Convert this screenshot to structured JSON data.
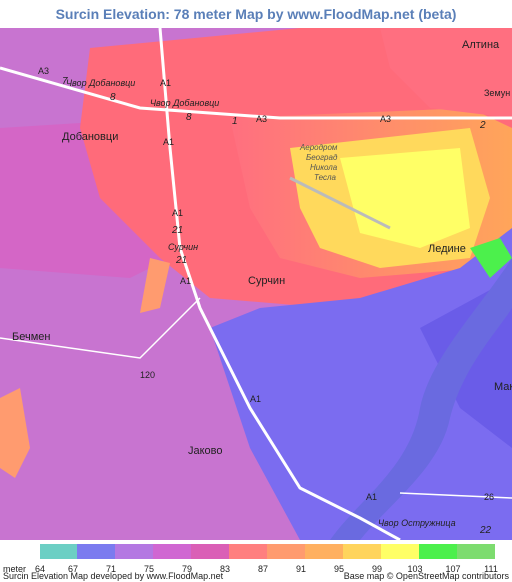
{
  "title": "Surcin Elevation: 78 meter Map by www.FloodMap.net (beta)",
  "map": {
    "places": [
      "Алтина",
      "Земун",
      "Добановци",
      "Бечмен",
      "Ледине",
      "Сурчин",
      "Јаково",
      "Мак"
    ],
    "roads": [
      {
        "ref": "A3",
        "color": "#ffffff"
      },
      {
        "ref": "A1",
        "color": "#ffffff"
      },
      {
        "ref": "120",
        "color": "#ffffff"
      },
      {
        "ref": "26",
        "color": "#ffffff"
      }
    ],
    "road_numbers": [
      "7",
      "8",
      "1",
      "2",
      "21",
      "21",
      "22"
    ],
    "interchanges": [
      "Чвор Добановци",
      "Чвор Добановци",
      "Сурчин",
      "Чвор Остружница"
    ],
    "airport": [
      "Аеродром",
      "Београд",
      "Никола",
      "Тесла"
    ]
  },
  "legend": {
    "unit": "meter",
    "labels": [
      "64",
      "67",
      "71",
      "75",
      "79",
      "83",
      "87",
      "91",
      "95",
      "99",
      "103",
      "107",
      "111"
    ],
    "colors": [
      "#6ccfc4",
      "#7b7bef",
      "#b478e2",
      "#d067d2",
      "#da5fb6",
      "#ff7f7f",
      "#ff9b6f",
      "#ffb060",
      "#ffd45c",
      "#ffff66",
      "#4cf04c",
      "#7ddc6f"
    ]
  },
  "footer": {
    "left": "Surcin Elevation Map developed by www.FloodMap.net",
    "right": "Base map © OpenStreetMap contributors"
  }
}
